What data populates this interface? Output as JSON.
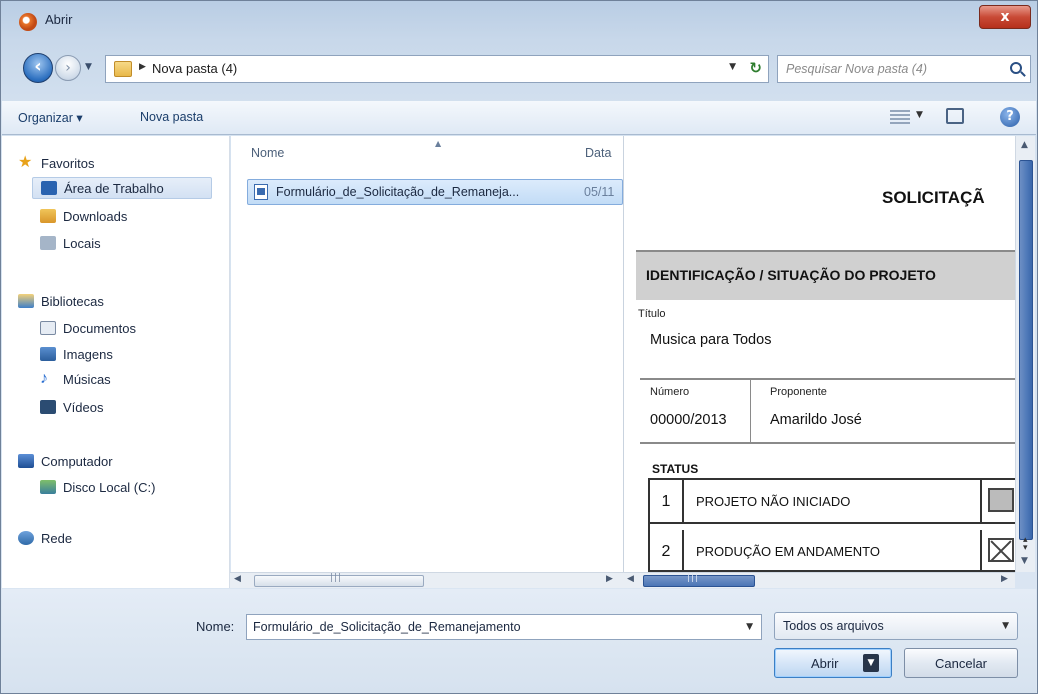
{
  "window": {
    "title": "Abrir",
    "close_label": "x"
  },
  "address": {
    "path": "Nova pasta (4)"
  },
  "search": {
    "placeholder": "Pesquisar Nova pasta (4)"
  },
  "toolbar": {
    "organize_label": "Organizar ▾",
    "new_folder_label": "Nova pasta"
  },
  "sidebar": {
    "favorites": "Favoritos",
    "desktop": "Área de Trabalho",
    "downloads": "Downloads",
    "places": "Locais",
    "libraries": "Bibliotecas",
    "documents": "Documentos",
    "images": "Imagens",
    "music": "Músicas",
    "videos": "Vídeos",
    "computer": "Computador",
    "local_disk": "Disco Local (C:)",
    "network": "Rede"
  },
  "filelist": {
    "columns": {
      "name": "Nome",
      "date": "Data"
    },
    "files": [
      {
        "name": "Formulário_de_Solicitação_de_Remaneja...",
        "date": "05/11"
      }
    ]
  },
  "preview": {
    "title": "SOLICITAÇÃ",
    "section": "IDENTIFICAÇÃO / SITUAÇÃO DO PROJETO",
    "title_label": "Título",
    "title_value": "Musica para Todos",
    "number_label": "Número",
    "number_value": "00000/2013",
    "proponent_label": "Proponente",
    "proponent_value": "Amarildo José",
    "status_label": "STATUS",
    "status_rows": [
      {
        "num": "1",
        "text": "PROJETO NÃO INICIADO"
      },
      {
        "num": "2",
        "text": "PRODUÇÃO EM ANDAMENTO"
      }
    ]
  },
  "footer": {
    "name_label": "Nome:",
    "name_value": "Formulário_de_Solicitação_de_Remanejamento",
    "file_type": "Todos os arquivos",
    "open_label": "Abrir",
    "cancel_label": "Cancelar"
  }
}
